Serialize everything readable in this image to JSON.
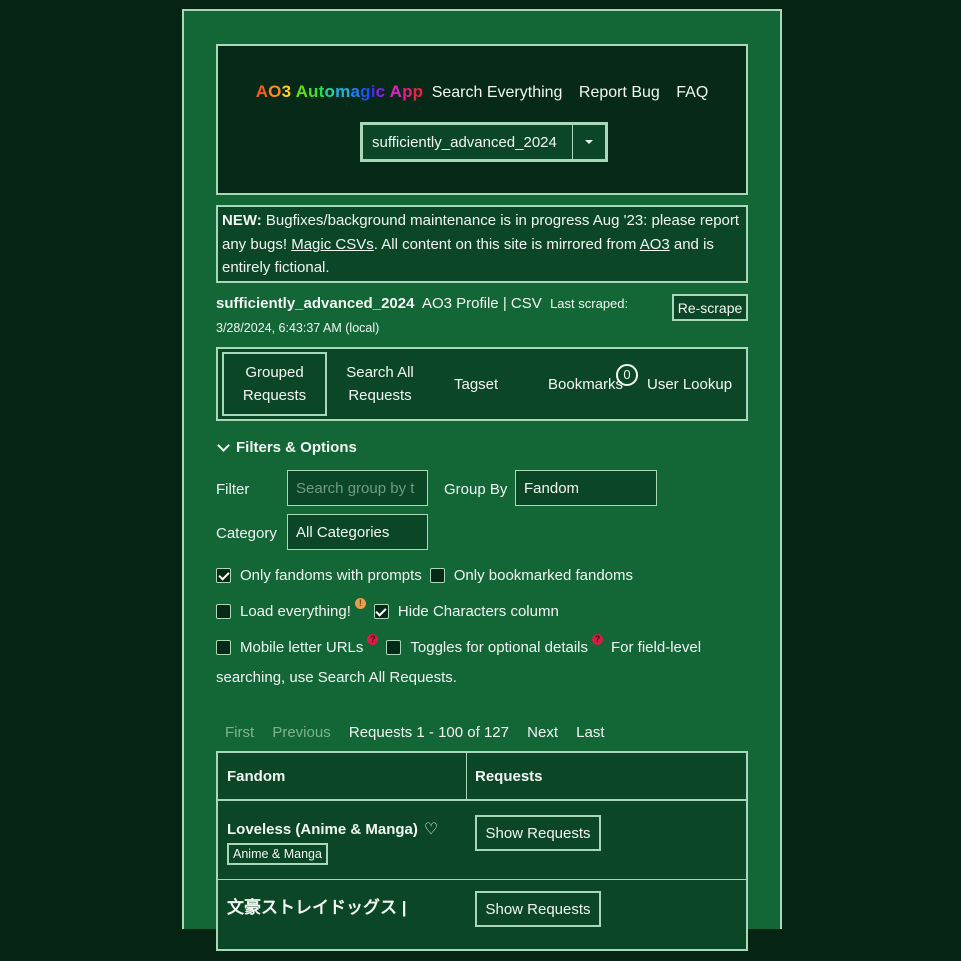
{
  "header": {
    "brand": [
      {
        "ch": "A",
        "color": "#ff5a1a"
      },
      {
        "ch": "O",
        "color": "#ff8a1a"
      },
      {
        "ch": "3",
        "color": "#ffd21a"
      },
      {
        "ch": " ",
        "color": "#ffffff"
      },
      {
        "ch": "A",
        "color": "#5fe01a"
      },
      {
        "ch": "u",
        "color": "#3fe030"
      },
      {
        "ch": "t",
        "color": "#20e050"
      },
      {
        "ch": "o",
        "color": "#20d8a0"
      },
      {
        "ch": "m",
        "color": "#20b0e0"
      },
      {
        "ch": "a",
        "color": "#2080f0"
      },
      {
        "ch": "g",
        "color": "#2050f0"
      },
      {
        "ch": "i",
        "color": "#4030e8"
      },
      {
        "ch": "c",
        "color": "#8a20e0"
      },
      {
        "ch": " ",
        "color": "#ffffff"
      },
      {
        "ch": "A",
        "color": "#e020c0"
      },
      {
        "ch": "p",
        "color": "#f01880"
      },
      {
        "ch": "p",
        "color": "#f02040"
      }
    ],
    "nav": [
      "Search Everything",
      "Report Bug",
      "FAQ"
    ],
    "collection_select": "sufficiently_advanced_2024"
  },
  "notice": {
    "prefix": "NEW:",
    "text1": " Bugfixes/background maintenance is in progress Aug '23: please report any bugs! ",
    "link1": "Magic CSVs",
    "text2": ". All content on this site is mirrored from ",
    "link2": "AO3",
    "text3": " and is entirely fictional."
  },
  "profile": {
    "username": "sufficiently_advanced_2024",
    "profile_link": "AO3 Profile",
    "sep": " | ",
    "csv_link": "CSV",
    "last_scraped_label": "Last scraped:",
    "last_scraped_value": "3/28/2024, 6:43:37 AM (local)",
    "rescrape": "Re-scrape"
  },
  "tabs": [
    {
      "line1": "Grouped",
      "line2": "Requests",
      "active": true
    },
    {
      "line1": "Search All",
      "line2": "Requests",
      "active": false
    },
    {
      "line1": "Tagset",
      "line2": "",
      "active": false
    },
    {
      "line1": "Bookmarks",
      "line2": "",
      "active": false,
      "badge": "0"
    },
    {
      "line1": "User Lookup",
      "line2": "",
      "active": false
    }
  ],
  "filters": {
    "title": "Filters & Options",
    "filter_label": "Filter",
    "filter_placeholder": "Search group by t",
    "groupby_label": "Group By",
    "groupby_value": "Fandom",
    "category_label": "Category",
    "category_value": "All Categories",
    "options": [
      {
        "label": "Only fandoms with prompts",
        "checked": true
      },
      {
        "label": "Only bookmarked fandoms",
        "checked": false
      },
      {
        "label": "Load everything!",
        "checked": false,
        "icon": "warning-icon"
      },
      {
        "label": "Hide Characters column",
        "checked": true
      },
      {
        "label": "Mobile letter URLs",
        "checked": false,
        "icon": "help-icon"
      },
      {
        "label": "Toggles for optional details",
        "checked": false,
        "icon": "help-icon"
      }
    ],
    "hint_line1": "For field-level",
    "hint_line2": "searching, use Search All Requests."
  },
  "pagination": {
    "first": "First",
    "previous": "Previous",
    "info": "Requests 1 - 100 of 127",
    "next": "Next",
    "last": "Last"
  },
  "table": {
    "headers": [
      "Fandom",
      "Requests"
    ],
    "rows": [
      {
        "fandom": "Loveless (Anime & Manga)",
        "category": "Anime & Manga",
        "button": "Show Requests"
      },
      {
        "fandom": "文豪ストレイドッグス |",
        "button": "Show Requests"
      }
    ]
  },
  "colors": {
    "page_bg": "#062414",
    "panel_bg": "#136636",
    "box_bg": "#0b4726",
    "header_bg": "#062a17",
    "border": "#a7d8b8"
  }
}
